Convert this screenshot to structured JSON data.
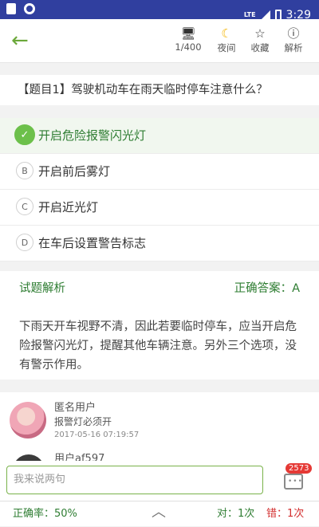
{
  "status_bar": {
    "time": "3:29",
    "network": "LTE"
  },
  "toolbar": {
    "page": "1/400",
    "night_label": "夜间",
    "favorite_label": "收藏",
    "explain_label": "解析"
  },
  "question": "【题目1】驾驶机动车在雨天临时停车注意什么？",
  "options": [
    {
      "letter": "A",
      "text": "开启危险报警闪光灯",
      "correct": true
    },
    {
      "letter": "B",
      "text": "开启前后雾灯"
    },
    {
      "letter": "C",
      "text": "开启近光灯"
    },
    {
      "letter": "D",
      "text": "在车后设置警告标志"
    }
  ],
  "analysis": {
    "title": "试题解析",
    "answer_label": "正确答案：A"
  },
  "explanation": "下雨天开车视野不清，因此若要临时停车，应当开启危险报警闪光灯，提醒其他车辆注意。另外三个选项，没有警示作用。",
  "comments": [
    {
      "user": "匿名用户",
      "text": "报警灯必须开",
      "time": "2017-05-16 07:19:57"
    },
    {
      "user": "用户af597"
    }
  ],
  "input": {
    "placeholder": "我来说两句"
  },
  "comment_count": "2573",
  "bottom": {
    "accuracy": "正确率：50%",
    "correct": "对：1次",
    "wrong": "错：1次"
  },
  "colors": {
    "accent_green": "#2e7d32",
    "status_bar": "#303f9f",
    "badge_red": "#e53935"
  }
}
